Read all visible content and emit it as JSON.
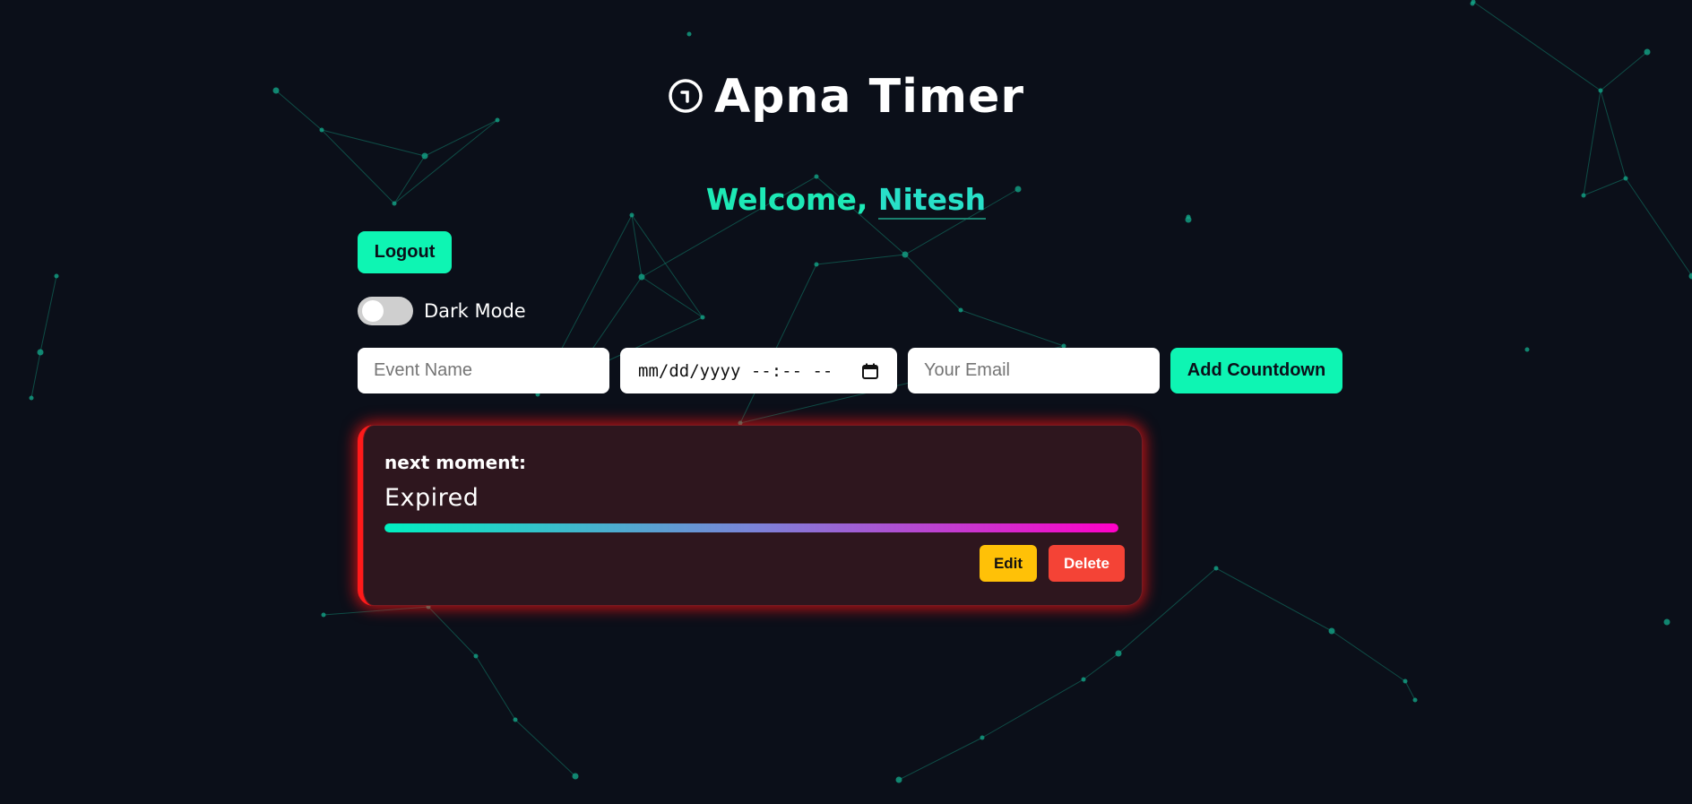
{
  "app": {
    "title": "Apna Timer",
    "title_icon": "clock-icon"
  },
  "welcome": {
    "prefix": "Welcome, ",
    "name": "Nitesh"
  },
  "auth": {
    "logout_label": "Logout"
  },
  "theme": {
    "dark_mode_label": "Dark Mode",
    "dark_mode_on": false
  },
  "form": {
    "event_placeholder": "Event Name",
    "date_placeholder": "mm/dd/yyyy --:-- --",
    "email_placeholder": "Your Email",
    "add_label": "Add Countdown"
  },
  "countdowns": [
    {
      "name": "next moment:",
      "status": "Expired",
      "progress": 1.0,
      "edit_label": "Edit",
      "delete_label": "Delete"
    }
  ],
  "colors": {
    "background": "#0b0f19",
    "accent": "#0ef5b3",
    "welcome": "#1de9b6",
    "card_border": "#ff1a1a",
    "edit": "#ffc107",
    "delete": "#f44336"
  }
}
